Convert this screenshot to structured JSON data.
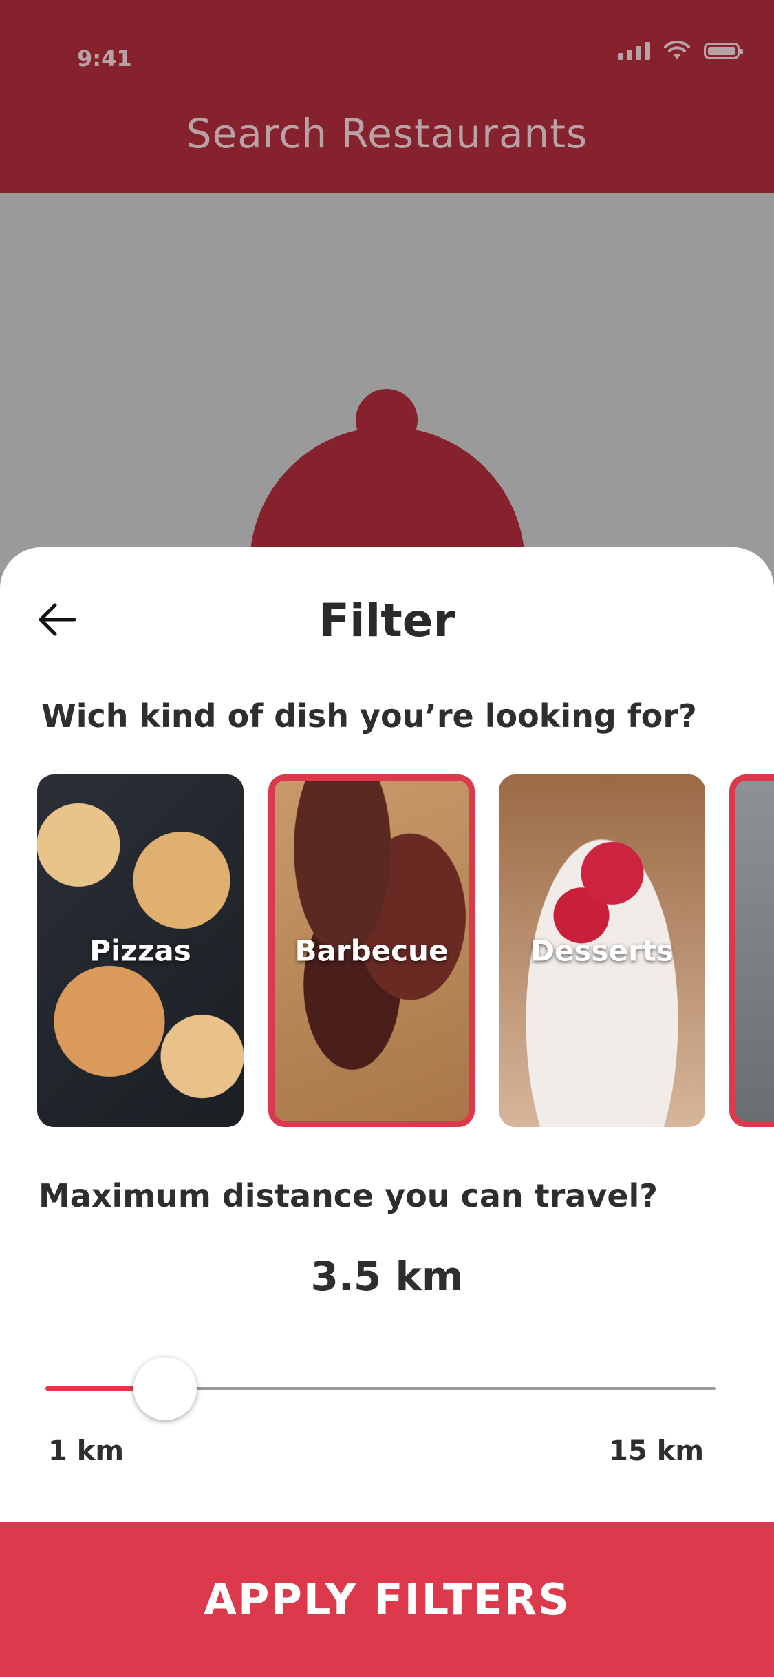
{
  "status_bar": {
    "time": "9:41"
  },
  "header": {
    "title": "Search Restaurants"
  },
  "sheet": {
    "title": "Filter",
    "dish_question": "Wich kind of dish you’re looking for?",
    "dishes": [
      {
        "label": "Pizzas",
        "selected": false
      },
      {
        "label": "Barbecue",
        "selected": true
      },
      {
        "label": "Desserts",
        "selected": false
      },
      {
        "label": "",
        "selected": true
      }
    ],
    "distance_question": "Maximum distance you can travel?",
    "distance": {
      "value_label": "3.5 km",
      "value": 3.5,
      "min": 1,
      "max": 15,
      "min_label": "1 km",
      "max_label": "15 km"
    },
    "apply_label": "APPLY FILTERS"
  },
  "colors": {
    "accent": "#dc3a4c",
    "header_dim": "#85222d",
    "text": "#2e2e2e"
  },
  "icons": {
    "back": "arrow-left-icon",
    "signal": "signal-icon",
    "wifi": "wifi-icon",
    "battery": "battery-icon"
  }
}
